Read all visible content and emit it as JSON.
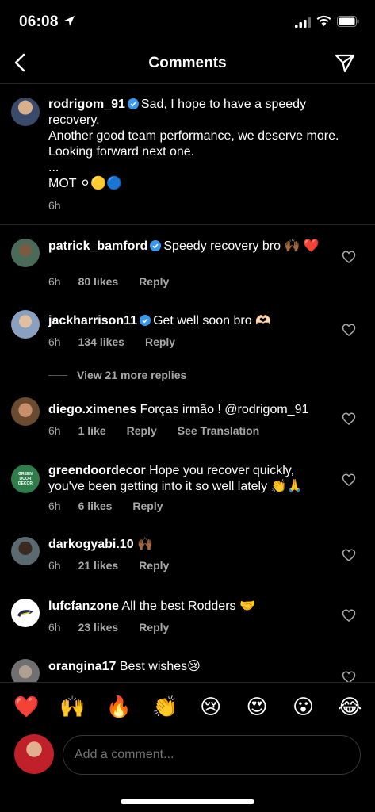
{
  "status_bar": {
    "time": "06:08"
  },
  "nav": {
    "title": "Comments"
  },
  "caption": {
    "username": "rodrigom_91",
    "lines": [
      "Sad, I hope to have a speedy",
      "recovery.",
      "Another good team performance, we deserve more.",
      "Looking forward next one.",
      "...",
      "MOT ⚪🟡🔵"
    ],
    "time": "6h"
  },
  "comments": [
    {
      "username": "patrick_bamford",
      "verified": true,
      "text": "Speedy recovery bro 🙌🏾 ❤️",
      "time": "6h",
      "likes": "80 likes",
      "reply": "Reply",
      "avatar_color": "#5a6a5a"
    },
    {
      "username": "jackharrison11",
      "verified": true,
      "text": "Get well soon bro 🫶🏻",
      "time": "6h",
      "likes": "134 likes",
      "reply": "Reply",
      "avatar_color": "#6a7a9a"
    },
    {
      "username": "diego.ximenes",
      "verified": false,
      "text": "Forças irmão ! @rodrigom_91",
      "time": "6h",
      "likes": "1 like",
      "reply": "Reply",
      "translate": "See Translation",
      "avatar_color": "#a07050"
    },
    {
      "username": "greendoordecor",
      "verified": false,
      "text": "Hope you recover quickly, you've been getting into it so well lately 👏🙏",
      "time": "6h",
      "likes": "6 likes",
      "reply": "Reply",
      "avatar_color": "#2e7d4a",
      "avatar_text": "GREEN DOOR DECOR"
    },
    {
      "username": "darkogyabi.10",
      "verified": false,
      "text": "🙌🏾",
      "time": "6h",
      "likes": "21 likes",
      "reply": "Reply",
      "avatar_color": "#555"
    },
    {
      "username": "lufcfanzone",
      "verified": false,
      "text": "All the best Rodders 🤝",
      "time": "6h",
      "likes": "23 likes",
      "reply": "Reply",
      "avatar_color": "#ffffff"
    },
    {
      "username": "orangina17",
      "verified": false,
      "text": "Best wishes😢",
      "time": "",
      "likes": "",
      "reply": "",
      "avatar_color": "#888"
    }
  ],
  "view_replies": "View 21 more replies",
  "emojis": [
    "❤️",
    "🙌",
    "🔥",
    "👏",
    "😢",
    "😍",
    "😮",
    "😂"
  ],
  "input": {
    "placeholder": "Add a comment..."
  },
  "colors": {
    "background": "#000000",
    "verified": "#3897f0",
    "muted": "#a8a8a8"
  }
}
